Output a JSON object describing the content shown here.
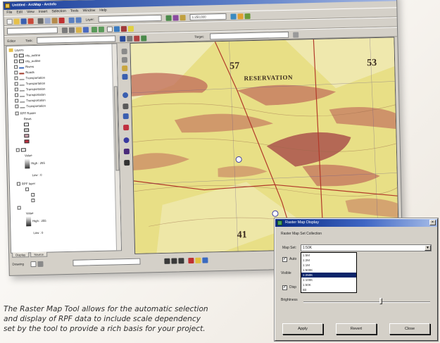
{
  "app": {
    "title": "Untitled - ArcMap - ArcInfo",
    "menu": [
      "File",
      "Edit",
      "View",
      "Insert",
      "Selection",
      "Tools",
      "Window",
      "Help"
    ],
    "layer_combo": "",
    "scale_combo": "1:250,000",
    "target_combo": "",
    "label_layer": "Layer:",
    "label_task": "Task:",
    "label_target": "Target:",
    "task_combo": "",
    "editor_label": "Editor"
  },
  "toc": {
    "rows": [
      "Layers",
      "city_outline",
      "city_outline",
      "Rivers",
      "Roads",
      "Transportation",
      "Transportation",
      "Transportation",
      "Transportation",
      "Transportation",
      "Transportation",
      "RPF Raster",
      "Rows",
      "Value",
      "High : 255",
      "Low : 0",
      "RPF layer",
      "Value",
      "High : 255",
      "Low : 0"
    ],
    "tabs": [
      "Display",
      "Source"
    ]
  },
  "map": {
    "reservation_label": "RESERVATION",
    "grid_labels": [
      "57",
      "53",
      "41"
    ],
    "colors": {
      "base": "#e8df86",
      "relief": "#c06a5a",
      "wash": "#f3efc8",
      "road": "#b23a2a",
      "grid": "#6a5a8a"
    }
  },
  "status": {
    "drawing_label": "Drawing"
  },
  "dialog": {
    "title": "Raster Map Display",
    "group_label": "Raster Map Set Collection",
    "map_set_label": "Map Set:",
    "map_set_value": "1:50K",
    "options": [
      "1:5M",
      "1:2M",
      "1:1M",
      "1:500K",
      "1:250K",
      "1:100K",
      "1:50K",
      "Bit"
    ],
    "selected_option": "1:250K",
    "auto_label": "Auto",
    "visible_label": "Visible",
    "display_label": "Disp",
    "brightness_label": "Brightness",
    "buttons": {
      "apply": "Apply",
      "revert": "Revert",
      "close": "Close"
    }
  },
  "caption": {
    "line1": "The Raster Map Tool allows for the automatic selection",
    "line2": "and display of RPF data to include scale dependency",
    "line3": "set by the tool to provide a rich basis for your project."
  }
}
